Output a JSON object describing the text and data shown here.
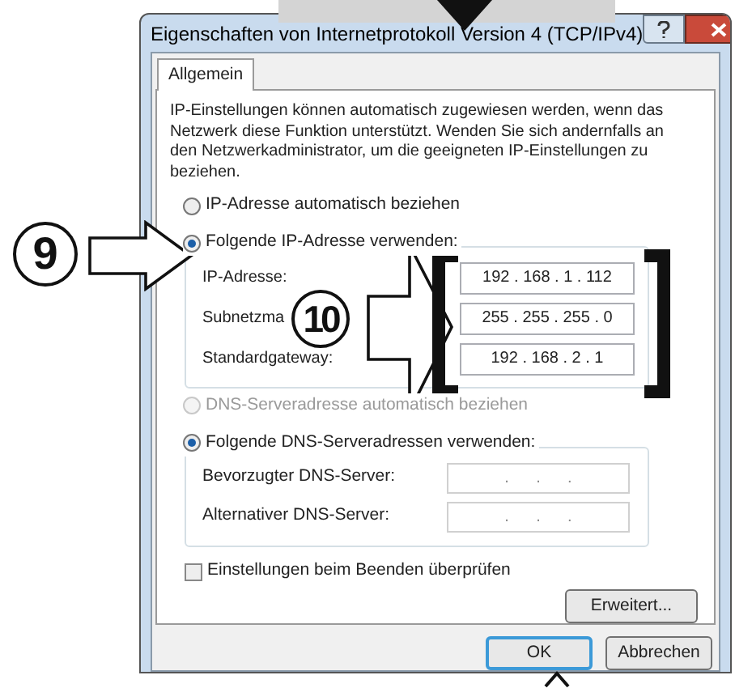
{
  "window": {
    "title": "Eigenschaften von Internetprotokoll Version 4 (TCP/IPv4)"
  },
  "tabs": [
    {
      "label": "Allgemein",
      "selected": true
    }
  ],
  "description": "IP-Einstellungen können automatisch zugewiesen werden, wenn das Netzwerk diese Funktion unterstützt. Wenden Sie sich andernfalls an den Netzwerkadministrator, um die geeigneten IP-Einstellungen zu beziehen.",
  "ip_options": [
    {
      "label": "IP-Adresse automatisch beziehen",
      "selected": false,
      "disabled": false
    },
    {
      "label": "Folgende IP-Adresse verwenden:",
      "selected": true,
      "disabled": false
    }
  ],
  "ip_fields": [
    {
      "label": "IP-Adresse:",
      "value": "192 . 168 . 1 . 112"
    },
    {
      "label": "Subnetzma",
      "value": "255 . 255 . 255 . 0"
    },
    {
      "label": "Standardgateway:",
      "value": "192 . 168 . 2 . 1"
    }
  ],
  "dns_options": [
    {
      "label": "DNS-Serveradresse automatisch beziehen",
      "selected": false,
      "disabled": true
    },
    {
      "label": "Folgende DNS-Serveradressen verwenden:",
      "selected": true,
      "disabled": false
    }
  ],
  "dns_fields": [
    {
      "label": "Bevorzugter DNS-Server:",
      "dots": [
        ".",
        ".",
        "."
      ]
    },
    {
      "label": "Alternativer DNS-Server:",
      "dots": [
        ".",
        ".",
        "."
      ]
    }
  ],
  "checkbox": {
    "label": "Einstellungen beim Beenden überprüfen",
    "checked": false
  },
  "advanced_button": "Erweitert...",
  "buttons": [
    {
      "label": "OK",
      "default": true
    },
    {
      "label": "Abbrechen",
      "default": false
    }
  ],
  "annotations": [
    {
      "label": "9"
    },
    {
      "label": "10"
    }
  ]
}
